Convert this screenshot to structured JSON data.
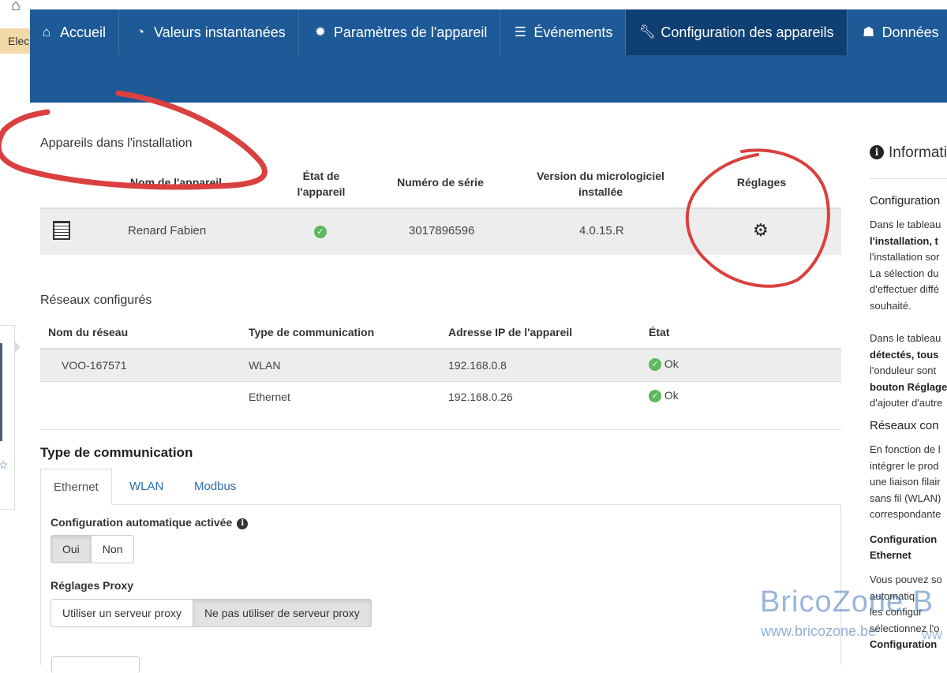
{
  "left_tab": {
    "label": "Elec"
  },
  "nav": {
    "items": [
      {
        "label": "Accueil",
        "icon": "home-icon"
      },
      {
        "label": "Valeurs instantanées",
        "icon": "gauge-icon"
      },
      {
        "label": "Paramètres de l'appareil",
        "icon": "gear-icon"
      },
      {
        "label": "Événements",
        "icon": "list-icon"
      },
      {
        "label": "Configuration des appareils",
        "icon": "wrench-icon"
      },
      {
        "label": "Données",
        "icon": "database-icon"
      }
    ],
    "active": "Configuration des appareils",
    "bg_color": "#1d5a97",
    "active_color": "#0f3f73"
  },
  "devices": {
    "title": "Appareils dans l'installation",
    "headers": {
      "name": "Nom de l'appareil",
      "state": "État de l'appareil",
      "serial": "Numéro de série",
      "firmware": "Version du micrologiciel installée",
      "settings": "Réglages"
    },
    "rows": [
      {
        "name": "Renard Fabien",
        "state": "ok",
        "serial": "3017896596",
        "firmware": "4.0.15.R"
      }
    ]
  },
  "networks": {
    "title": "Réseaux configurés",
    "headers": {
      "name": "Nom du réseau",
      "type": "Type de communication",
      "ip": "Adresse IP de l'appareil",
      "state": "État"
    },
    "rows": [
      {
        "name": "VOO-167571",
        "type": "WLAN",
        "ip": "192.168.0.8",
        "state": "Ok"
      },
      {
        "name": "",
        "type": "Ethernet",
        "ip": "192.168.0.26",
        "state": "Ok"
      }
    ]
  },
  "communication": {
    "title": "Type de communication",
    "tabs": [
      "Ethernet",
      "WLAN",
      "Modbus"
    ],
    "active_tab": "Ethernet",
    "auto_config_label": "Configuration automatique activée",
    "auto_config_options": [
      "Oui",
      "Non"
    ],
    "auto_config_selected": "Oui",
    "proxy_label": "Réglages Proxy",
    "proxy_options": [
      "Utiliser un serveur proxy",
      "Ne pas utiliser de serveur proxy"
    ],
    "proxy_selected": "Ne pas utiliser de serveur proxy"
  },
  "info_panel": {
    "title": "Informati",
    "h1": "Configuration",
    "p1": [
      "Dans le tableau",
      "l'installation, t",
      "l'installation sor",
      "La sélection du",
      "d'effectuer diffé",
      "souhaité."
    ],
    "p2": [
      "Dans le tableau",
      "détectés, tous",
      "l'onduleur sont",
      "bouton Réglage",
      "d'ajouter d'autre"
    ],
    "h2": "Réseaux con",
    "p3": [
      "En fonction de l",
      "intégrer le prod",
      "une liaison filair",
      "sans fil (WLAN)",
      "correspondante"
    ],
    "h3": [
      "Configuration",
      "Ethernet"
    ],
    "p4": [
      "Vous pouvez so",
      "automatiq",
      "les configur",
      "sélectionnez l'o",
      "Configuration"
    ]
  },
  "watermark": {
    "line1": "BricoZone",
    "line1_partial": "B",
    "line2": "www.bricozone.be",
    "line2_partial": "ww"
  }
}
